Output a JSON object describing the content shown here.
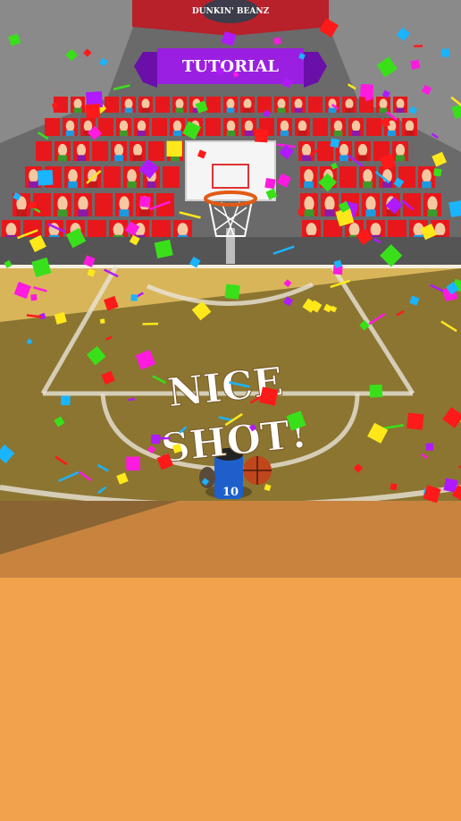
{
  "game": {
    "sponsor_banner": "DUNKIN' BEANZ",
    "level_banner": "TUTORIAL",
    "shot_message_line1": "NICE",
    "shot_message_line2": "SHOT!",
    "player_number": "10"
  },
  "colors": {
    "court_light": "#d9b55a",
    "court_shadow": "#7d6a2a",
    "seat_red": "#e8171b",
    "banner_purple": "#9b1fe0",
    "sponsor_red": "#b8202a",
    "footer_orange": "#f2a24c"
  },
  "confetti_colors": [
    "#ff1a1a",
    "#ffe81a",
    "#39e01a",
    "#1ab4ff",
    "#b01aff",
    "#ff1ae0"
  ]
}
